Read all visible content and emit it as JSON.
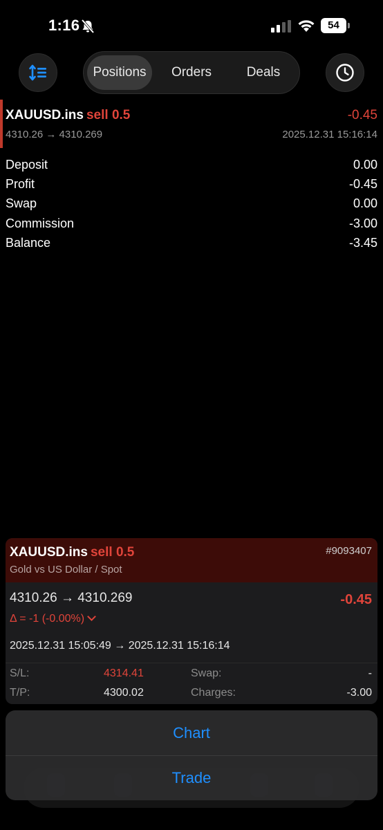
{
  "status_bar": {
    "time": "1:16",
    "battery": "54"
  },
  "toolbar": {
    "tabs": [
      {
        "label": "Positions",
        "active": true
      },
      {
        "label": "Orders",
        "active": false
      },
      {
        "label": "Deals",
        "active": false
      }
    ]
  },
  "deal": {
    "symbol": "XAUUSD.ins",
    "side": "sell 0.5",
    "profit": "-0.45",
    "prices": "4310.26 → 4310.269",
    "time": "2025.12.31 15:16:14"
  },
  "summary": [
    {
      "label": "Deposit",
      "value": "0.00"
    },
    {
      "label": "Profit",
      "value": "-0.45"
    },
    {
      "label": "Swap",
      "value": "0.00"
    },
    {
      "label": "Commission",
      "value": "-3.00"
    },
    {
      "label": "Balance",
      "value": "-3.45"
    }
  ],
  "detail": {
    "symbol": "XAUUSD.ins",
    "side": "sell 0.5",
    "ticket": "#9093407",
    "description": "Gold vs US Dollar / Spot",
    "prices": "4310.26 → 4310.269",
    "profit": "-0.45",
    "delta": "Δ = -1 (-0.00%)",
    "times": "2025.12.31 15:05:49 → 2025.12.31 15:16:14",
    "sl_label": "S/L:",
    "sl_value": "4314.41",
    "tp_label": "T/P:",
    "tp_value": "4300.02",
    "swap_label": "Swap:",
    "swap_value": "-",
    "charges_label": "Charges:",
    "charges_value": "-3.00"
  },
  "action_sheet": {
    "chart": "Chart",
    "trade": "Trade"
  },
  "colors": {
    "accent_blue": "#1f8fff",
    "loss_red": "#e0443a",
    "card_header": "#3d0c08"
  }
}
